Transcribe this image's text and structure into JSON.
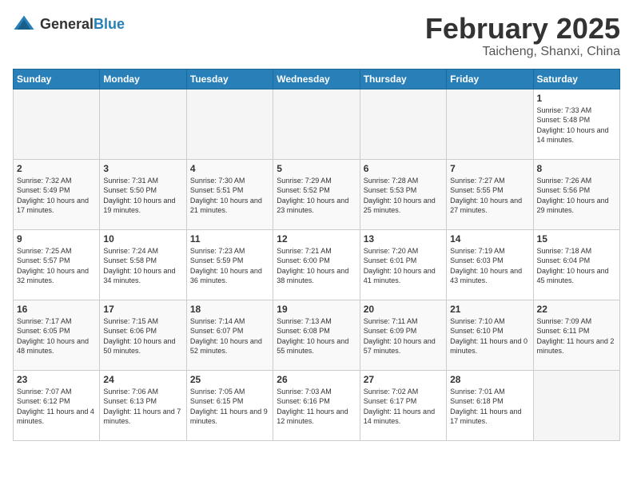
{
  "header": {
    "logo_general": "General",
    "logo_blue": "Blue",
    "title": "February 2025",
    "subtitle": "Taicheng, Shanxi, China"
  },
  "weekdays": [
    "Sunday",
    "Monday",
    "Tuesday",
    "Wednesday",
    "Thursday",
    "Friday",
    "Saturday"
  ],
  "weeks": [
    [
      {
        "day": "",
        "info": ""
      },
      {
        "day": "",
        "info": ""
      },
      {
        "day": "",
        "info": ""
      },
      {
        "day": "",
        "info": ""
      },
      {
        "day": "",
        "info": ""
      },
      {
        "day": "",
        "info": ""
      },
      {
        "day": "1",
        "info": "Sunrise: 7:33 AM\nSunset: 5:48 PM\nDaylight: 10 hours and 14 minutes."
      }
    ],
    [
      {
        "day": "2",
        "info": "Sunrise: 7:32 AM\nSunset: 5:49 PM\nDaylight: 10 hours and 17 minutes."
      },
      {
        "day": "3",
        "info": "Sunrise: 7:31 AM\nSunset: 5:50 PM\nDaylight: 10 hours and 19 minutes."
      },
      {
        "day": "4",
        "info": "Sunrise: 7:30 AM\nSunset: 5:51 PM\nDaylight: 10 hours and 21 minutes."
      },
      {
        "day": "5",
        "info": "Sunrise: 7:29 AM\nSunset: 5:52 PM\nDaylight: 10 hours and 23 minutes."
      },
      {
        "day": "6",
        "info": "Sunrise: 7:28 AM\nSunset: 5:53 PM\nDaylight: 10 hours and 25 minutes."
      },
      {
        "day": "7",
        "info": "Sunrise: 7:27 AM\nSunset: 5:55 PM\nDaylight: 10 hours and 27 minutes."
      },
      {
        "day": "8",
        "info": "Sunrise: 7:26 AM\nSunset: 5:56 PM\nDaylight: 10 hours and 29 minutes."
      }
    ],
    [
      {
        "day": "9",
        "info": "Sunrise: 7:25 AM\nSunset: 5:57 PM\nDaylight: 10 hours and 32 minutes."
      },
      {
        "day": "10",
        "info": "Sunrise: 7:24 AM\nSunset: 5:58 PM\nDaylight: 10 hours and 34 minutes."
      },
      {
        "day": "11",
        "info": "Sunrise: 7:23 AM\nSunset: 5:59 PM\nDaylight: 10 hours and 36 minutes."
      },
      {
        "day": "12",
        "info": "Sunrise: 7:21 AM\nSunset: 6:00 PM\nDaylight: 10 hours and 38 minutes."
      },
      {
        "day": "13",
        "info": "Sunrise: 7:20 AM\nSunset: 6:01 PM\nDaylight: 10 hours and 41 minutes."
      },
      {
        "day": "14",
        "info": "Sunrise: 7:19 AM\nSunset: 6:03 PM\nDaylight: 10 hours and 43 minutes."
      },
      {
        "day": "15",
        "info": "Sunrise: 7:18 AM\nSunset: 6:04 PM\nDaylight: 10 hours and 45 minutes."
      }
    ],
    [
      {
        "day": "16",
        "info": "Sunrise: 7:17 AM\nSunset: 6:05 PM\nDaylight: 10 hours and 48 minutes."
      },
      {
        "day": "17",
        "info": "Sunrise: 7:15 AM\nSunset: 6:06 PM\nDaylight: 10 hours and 50 minutes."
      },
      {
        "day": "18",
        "info": "Sunrise: 7:14 AM\nSunset: 6:07 PM\nDaylight: 10 hours and 52 minutes."
      },
      {
        "day": "19",
        "info": "Sunrise: 7:13 AM\nSunset: 6:08 PM\nDaylight: 10 hours and 55 minutes."
      },
      {
        "day": "20",
        "info": "Sunrise: 7:11 AM\nSunset: 6:09 PM\nDaylight: 10 hours and 57 minutes."
      },
      {
        "day": "21",
        "info": "Sunrise: 7:10 AM\nSunset: 6:10 PM\nDaylight: 11 hours and 0 minutes."
      },
      {
        "day": "22",
        "info": "Sunrise: 7:09 AM\nSunset: 6:11 PM\nDaylight: 11 hours and 2 minutes."
      }
    ],
    [
      {
        "day": "23",
        "info": "Sunrise: 7:07 AM\nSunset: 6:12 PM\nDaylight: 11 hours and 4 minutes."
      },
      {
        "day": "24",
        "info": "Sunrise: 7:06 AM\nSunset: 6:13 PM\nDaylight: 11 hours and 7 minutes."
      },
      {
        "day": "25",
        "info": "Sunrise: 7:05 AM\nSunset: 6:15 PM\nDaylight: 11 hours and 9 minutes."
      },
      {
        "day": "26",
        "info": "Sunrise: 7:03 AM\nSunset: 6:16 PM\nDaylight: 11 hours and 12 minutes."
      },
      {
        "day": "27",
        "info": "Sunrise: 7:02 AM\nSunset: 6:17 PM\nDaylight: 11 hours and 14 minutes."
      },
      {
        "day": "28",
        "info": "Sunrise: 7:01 AM\nSunset: 6:18 PM\nDaylight: 11 hours and 17 minutes."
      },
      {
        "day": "",
        "info": ""
      }
    ]
  ]
}
